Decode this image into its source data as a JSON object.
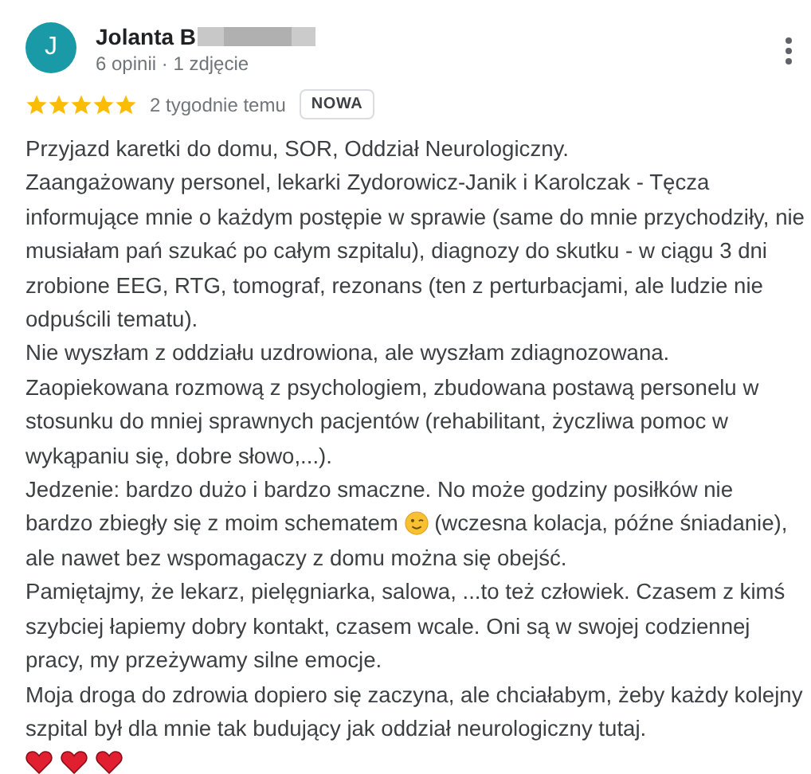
{
  "review": {
    "author": {
      "initial": "J",
      "name": "Jolanta B",
      "meta": "6 opinii · 1 zdjęcie"
    },
    "stars": 5,
    "time": "2 tygodnie temu",
    "badge": "NOWA",
    "paragraphs": [
      {
        "parts": [
          {
            "kind": "text",
            "text": "Przyjazd karetki do domu, SOR, Oddział Neurologiczny."
          }
        ]
      },
      {
        "parts": [
          {
            "kind": "text",
            "text": "Zaangażowany personel, lekarki Zydorowicz-Janik i Karolczak - Tęcza informujące mnie o każdym postępie w sprawie (same do mnie przychodziły, nie musiałam pań szukać po całym szpitalu), diagnozy do skutku - w ciągu 3 dni zrobione EEG, RTG, tomograf, rezonans (ten z perturbacjami, ale ludzie nie odpuścili tematu)."
          }
        ]
      },
      {
        "parts": [
          {
            "kind": "text",
            "text": "Nie wyszłam z oddziału uzdrowiona, ale wyszłam zdiagnozowana."
          }
        ]
      },
      {
        "parts": [
          {
            "kind": "text",
            "text": "Zaopiekowana rozmową z psychologiem, zbudowana postawą personelu w stosunku do mniej sprawnych pacjentów (rehabilitant, życzliwa pomoc w wykąpaniu się, dobre słowo,...)."
          }
        ]
      },
      {
        "parts": [
          {
            "kind": "text",
            "text": "Jedzenie: bardzo dużo i bardzo smaczne. No może godziny posiłków nie"
          },
          {
            "kind": "text",
            "text": "bardzo zbiegły się z moim schematem"
          },
          {
            "kind": "wink-emoji"
          },
          {
            "kind": "text",
            "text": "(wczesna kolacja, późne śniadanie),"
          },
          {
            "kind": "text",
            "text": "ale nawet bez wspomagaczy z domu można się obejść."
          }
        ]
      },
      {
        "parts": [
          {
            "kind": "text",
            "text": "Pamiętajmy, że lekarz, pielęgniarka, salowa, ...to też człowiek. Czasem z kimś szybciej łapiemy dobry kontakt, czasem wcale. Oni są w swojej codziennej pracy, my przeżywamy silne emocje."
          }
        ]
      },
      {
        "parts": [
          {
            "kind": "text",
            "text": "Moja droga do zdrowia dopiero się zaczyna, ale chciałabym, żeby każdy kolejny szpital był dla mnie tak budujący jak oddział neurologiczny tutaj."
          }
        ]
      },
      {
        "parts": [
          {
            "kind": "heart-emoji"
          },
          {
            "kind": "heart-emoji"
          },
          {
            "kind": "heart-emoji"
          }
        ]
      }
    ]
  }
}
